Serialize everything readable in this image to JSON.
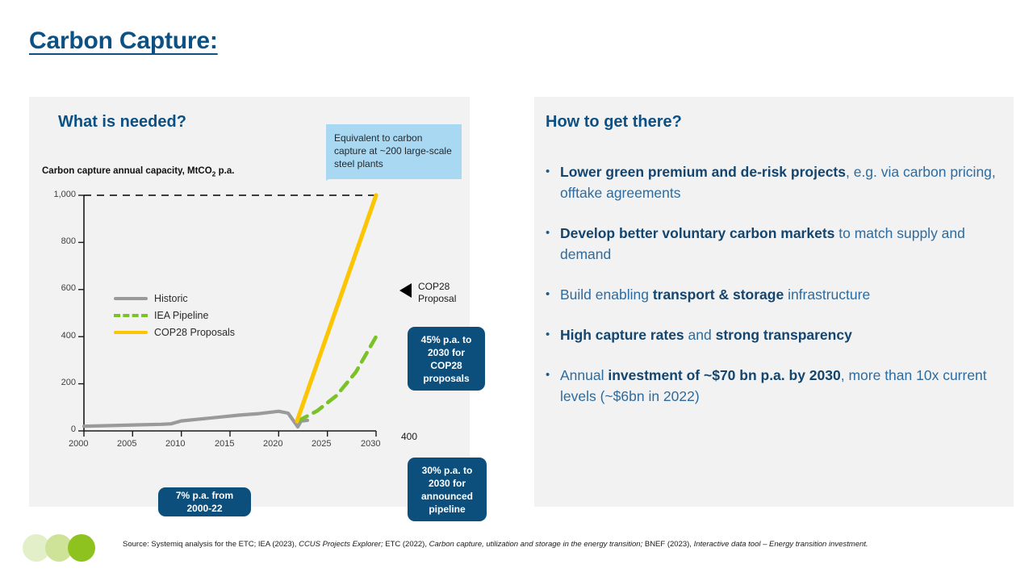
{
  "slide": {
    "title": "Carbon Capture:"
  },
  "left_panel": {
    "heading": "What is needed?",
    "chart_title_prefix": "Carbon capture annual capacity, MtCO",
    "chart_title_sub": "2",
    "chart_title_suffix": " p.a.",
    "legend": [
      {
        "label": "Historic",
        "color": "#9a9a9a",
        "style": "solid"
      },
      {
        "label": "IEA Pipeline",
        "color": "#7ac225",
        "style": "dashed"
      },
      {
        "label": "COP28 Proposals",
        "color": "#fdc500",
        "style": "solid"
      }
    ],
    "callout_steel": "Equivalent to carbon capture at ~200 large-scale steel plants",
    "annotation_cop28_proposal": "COP28 Proposal",
    "annotation_pipeline_value": "400",
    "box_cop28_growth": "45% p.a. to 2030 for COP28 proposals",
    "box_pipeline_growth": "30% p.a. to 2030 for announced pipeline",
    "box_historic_growth": "7% p.a. from 2000-22"
  },
  "right_panel": {
    "heading": "How to get there?",
    "bullet_marker": "•",
    "bullets": [
      {
        "bold1": "Lower green premium and de-risk projects",
        "rest": ", e.g. via carbon pricing,  offtake agreements"
      },
      {
        "bold1": "Develop better voluntary carbon markets",
        "rest": " to match supply and demand"
      },
      {
        "pre": "Build enabling ",
        "bold1": "transport & storage",
        "rest": " infrastructure"
      },
      {
        "bold1": "High capture rates",
        "mid": " and ",
        "bold2": "strong transparency",
        "rest": ""
      },
      {
        "pre": "Annual ",
        "bold1": "investment of ~$70 bn p.a. by 2030",
        "rest": ", more than 10x current levels (~$6bn in 2022)"
      }
    ]
  },
  "footer": {
    "source_line1_a": "Source: Systemiq analysis for the ETC;  IEA (2023), ",
    "source_line1_b": "CCUS Projects Explorer;",
    "source_line1_c": " ETC  (2022), ",
    "source_line1_d": "Carbon capture, utilization and storage in the energy transition;",
    "source_line1_e": " BNEF (2023), ",
    "source_line1_f": "Interactive data tool – Energy  transition investment.",
    "logo_colors": [
      "#e3efc8",
      "#cfe398",
      "#8dc21f"
    ]
  },
  "chart_data": {
    "type": "line",
    "title": "Carbon capture annual capacity, MtCO2 p.a.",
    "xlabel": "",
    "ylabel": "MtCO2 p.a.",
    "xlim": [
      2000,
      2030
    ],
    "ylim": [
      0,
      1000
    ],
    "xticks": [
      2000,
      2005,
      2010,
      2015,
      2020,
      2025,
      2030
    ],
    "yticks": [
      0,
      200,
      400,
      600,
      800,
      1000
    ],
    "ytick_labels": [
      "0",
      "200",
      "400",
      "600",
      "800",
      "1,000"
    ],
    "grid": false,
    "legend_position": "upper-left-inside",
    "reference_line": {
      "y": 1000,
      "style": "dashed",
      "color": "#000000",
      "label": "COP28 Proposal"
    },
    "series": [
      {
        "name": "Historic",
        "color": "#9a9a9a",
        "style": "solid",
        "x": [
          2000,
          2002,
          2004,
          2006,
          2008,
          2009,
          2010,
          2012,
          2014,
          2016,
          2018,
          2020,
          2021,
          2022,
          2023
        ],
        "y": [
          10,
          11,
          12,
          13,
          14,
          15,
          22,
          26,
          30,
          34,
          37,
          42,
          38,
          45,
          48
        ]
      },
      {
        "name": "IEA Pipeline",
        "color": "#7ac225",
        "style": "dashed",
        "x": [
          2022,
          2024,
          2026,
          2028,
          2030
        ],
        "y": [
          45,
          85,
          150,
          250,
          400
        ]
      },
      {
        "name": "COP28 Proposals",
        "color": "#fdc500",
        "style": "solid",
        "x": [
          2022,
          2030
        ],
        "y": [
          45,
          1000
        ]
      }
    ],
    "annotations": [
      {
        "text": "400",
        "x": 2030,
        "y": 400
      },
      {
        "text": "COP28 Proposal",
        "x": 2030,
        "y": 1000
      },
      {
        "text": "45% p.a. to 2030 for COP28 proposals"
      },
      {
        "text": "30% p.a. to 2030 for announced pipeline"
      },
      {
        "text": "7% p.a. from 2000-22"
      },
      {
        "text": "Equivalent to carbon capture at ~200 large-scale steel plants"
      }
    ]
  }
}
